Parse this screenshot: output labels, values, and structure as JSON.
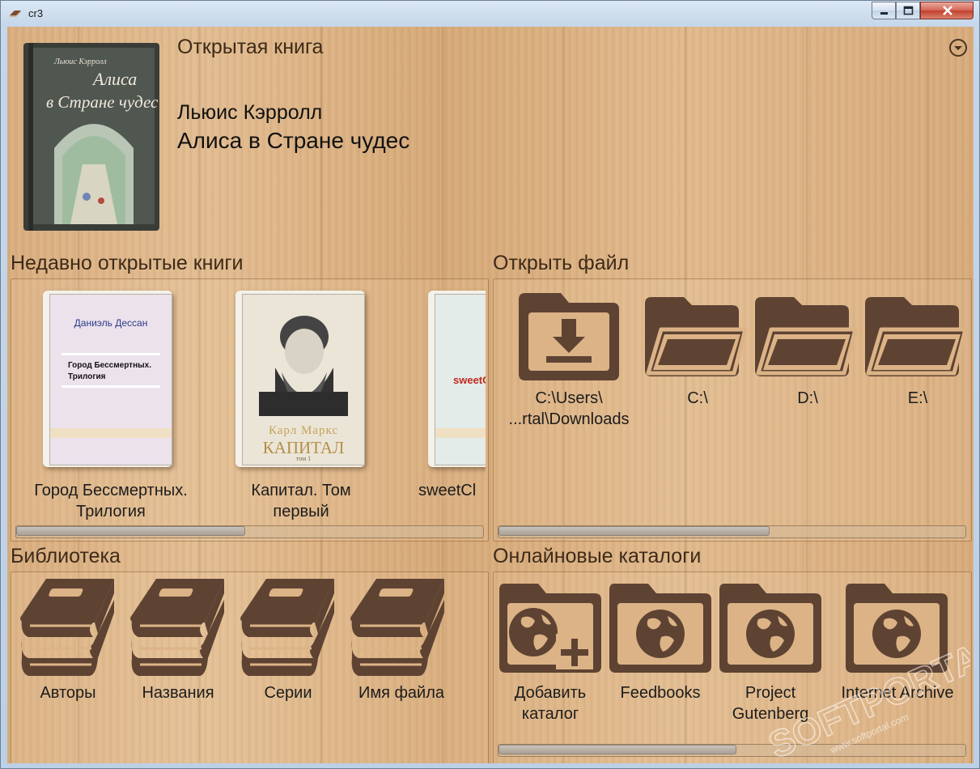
{
  "window": {
    "title": "cr3"
  },
  "current_book": {
    "section_label": "Открытая книга",
    "author": "Льюис Кэрролл",
    "title": "Алиса в Стране чудес",
    "cover": {
      "author_line": "Льюис Кэрролл",
      "title_line1": "Алиса",
      "title_line2": "в Стране чудес"
    }
  },
  "recent": {
    "header": "Недавно открытые книги",
    "books": [
      {
        "label_line1": "Город Бессмертных.",
        "label_line2": "Трилогия",
        "cover_author": "Даниэль  Дессан",
        "cover_title1": "Город Бессмертных.",
        "cover_title2": "Трилогия"
      },
      {
        "label_line1": "Капитал. Том",
        "label_line2": "первый",
        "cover_author": "Карл Маркс",
        "cover_title1": "КАПИТАЛ",
        "cover_title2": "том 1"
      },
      {
        "label_line1": "sweetCl",
        "label_line2": "",
        "cover_title1": "sweetC"
      }
    ],
    "scroll_fraction": 0.49
  },
  "open_file": {
    "header": "Открыть файл",
    "items": [
      {
        "label_line1": "C:\\Users\\",
        "label_line2": "...rtal\\Downloads",
        "icon": "download-folder-icon"
      },
      {
        "label_line1": "C:\\",
        "label_line2": "",
        "icon": "folder-icon"
      },
      {
        "label_line1": "D:\\",
        "label_line2": "",
        "icon": "folder-icon"
      },
      {
        "label_line1": "E:\\",
        "label_line2": "",
        "icon": "folder-icon"
      }
    ],
    "scroll_fraction": 0.58
  },
  "library": {
    "header": "Библиотека",
    "items": [
      {
        "label": "Авторы",
        "icon": "books-icon"
      },
      {
        "label": "Названия",
        "icon": "books-icon"
      },
      {
        "label": "Серии",
        "icon": "books-icon"
      },
      {
        "label": "Имя файла",
        "icon": "books-icon"
      }
    ]
  },
  "catalogs": {
    "header": "Онлайновые каталоги",
    "items": [
      {
        "label_line1": "Добавить",
        "label_line2": "каталог",
        "icon": "add-catalog-icon"
      },
      {
        "label_line1": "Feedbooks",
        "label_line2": "",
        "icon": "globe-folder-icon"
      },
      {
        "label_line1": "Project",
        "label_line2": "Gutenberg",
        "icon": "globe-folder-icon"
      },
      {
        "label_line1": "Internet Archive",
        "label_line2": "",
        "icon": "globe-folder-icon"
      }
    ],
    "scroll_fraction": 0.51
  },
  "watermark": {
    "brand": "SOFTPORTAL",
    "url": "www.softportal.com"
  },
  "colors": {
    "icon_brown": "#5e4333",
    "header_text": "#3d2a19",
    "wood": "#dcb386"
  }
}
